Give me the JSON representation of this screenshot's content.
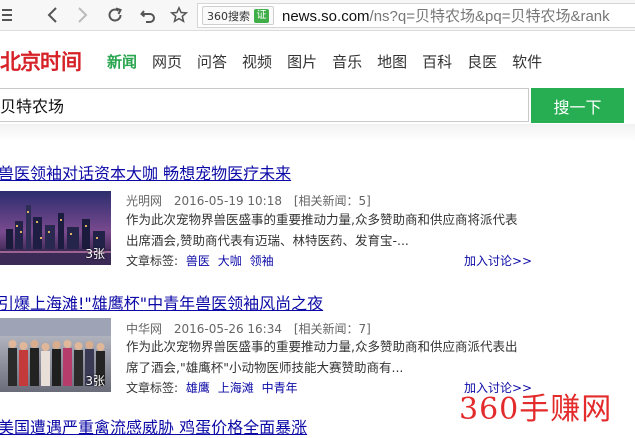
{
  "browser": {
    "engine_badge": "360搜索",
    "cert_label": "证",
    "url_host": "news.so.com",
    "url_rest": "/ns?q=贝特农场&pq=贝特农场&rank"
  },
  "channel": {
    "logo_part1": "北京",
    "logo_part2": "时间",
    "tabs": [
      "新闻",
      "网页",
      "问答",
      "视频",
      "图片",
      "音乐",
      "地图",
      "百科",
      "良医",
      "软件"
    ],
    "active_tab": "新闻"
  },
  "search": {
    "query": "贝特农场",
    "button_label": "搜一下"
  },
  "results": [
    {
      "title": "兽医领袖对话资本大咖 畅想宠物医疗未来",
      "source": "光明网",
      "time": "2016-05-19 10:18",
      "related": "[相关新闻：5]",
      "summary": "作为此次宠物界兽医盛事的重要推动力量,众多赞助商和供应商将派代表出席酒会,赞助商代表有迈瑞、林特医药、发育宝-...",
      "image_count": "3张",
      "tags_label": "文章标签:",
      "tags": [
        "兽医",
        "大咖",
        "领袖"
      ],
      "discuss": "加入讨论>>"
    },
    {
      "title": "引爆上海滩!\"雄鹰杯\"中青年兽医领袖风尚之夜",
      "source": "中华网",
      "time": "2016-05-26 16:34",
      "related": "[相关新闻：7]",
      "summary": "作为此次宠物界兽医盛事的重要推动力量,众多赞助商和供应商派代表出席了酒会,\"雄鹰杯\"小动物医师技能大赛赞助商有...",
      "image_count": "3张",
      "tags_label": "文章标签:",
      "tags": [
        "雄鹰",
        "上海滩",
        "中青年"
      ],
      "discuss": "加入讨论>>"
    },
    {
      "title": "美国遭遇严重禽流感威胁 鸡蛋价格全面暴涨"
    }
  ],
  "watermark": "360手赚网",
  "colors": {
    "accent": "#27ae52",
    "link": "#0c0aa6",
    "brand": "#d52127"
  }
}
